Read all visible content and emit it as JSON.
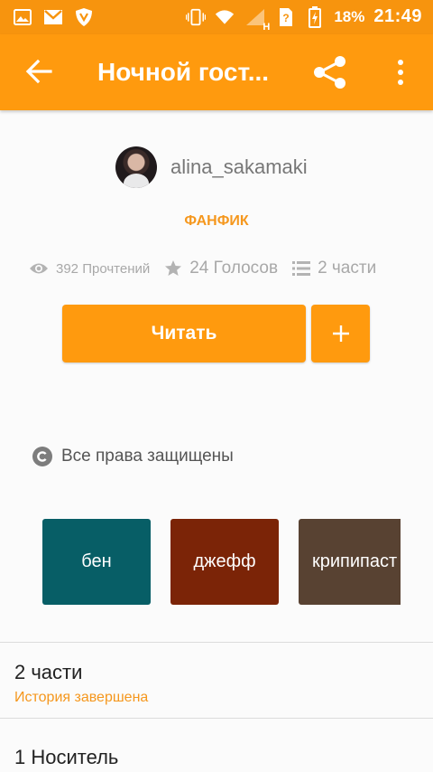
{
  "status_bar": {
    "battery": "18%",
    "time": "21:49",
    "network": "H",
    "icons": [
      "gallery-icon",
      "gmail-icon",
      "shield-icon",
      "vibrate-icon",
      "wifi-icon",
      "signal-icon",
      "sim-icon",
      "battery-icon"
    ]
  },
  "toolbar": {
    "title": "Ночной гост...",
    "back_icon": "arrow-left-icon",
    "share_icon": "share-icon",
    "more_icon": "more-vert-icon"
  },
  "author": {
    "name": "alina_sakamaki"
  },
  "story_type": "ФАНФИК",
  "stats": {
    "views": "392 Прочтений",
    "votes": "24 Голосов",
    "parts": "2 части"
  },
  "actions": {
    "read_label": "Читать",
    "add_label": "+"
  },
  "copyright": "Все права защищены",
  "tags": [
    {
      "label": "бен",
      "color": "#075e66"
    },
    {
      "label": "джефф",
      "color": "#7b2407"
    },
    {
      "label": "крипипаст",
      "color": "#584232"
    }
  ],
  "parts_section": {
    "title": "2 части",
    "status": "История завершена"
  },
  "carrier_section": {
    "title": "1 Носитель"
  },
  "colors": {
    "accent": "#ff9a0e",
    "status_bar": "#f7940e",
    "accent_text": "#f5971d"
  }
}
